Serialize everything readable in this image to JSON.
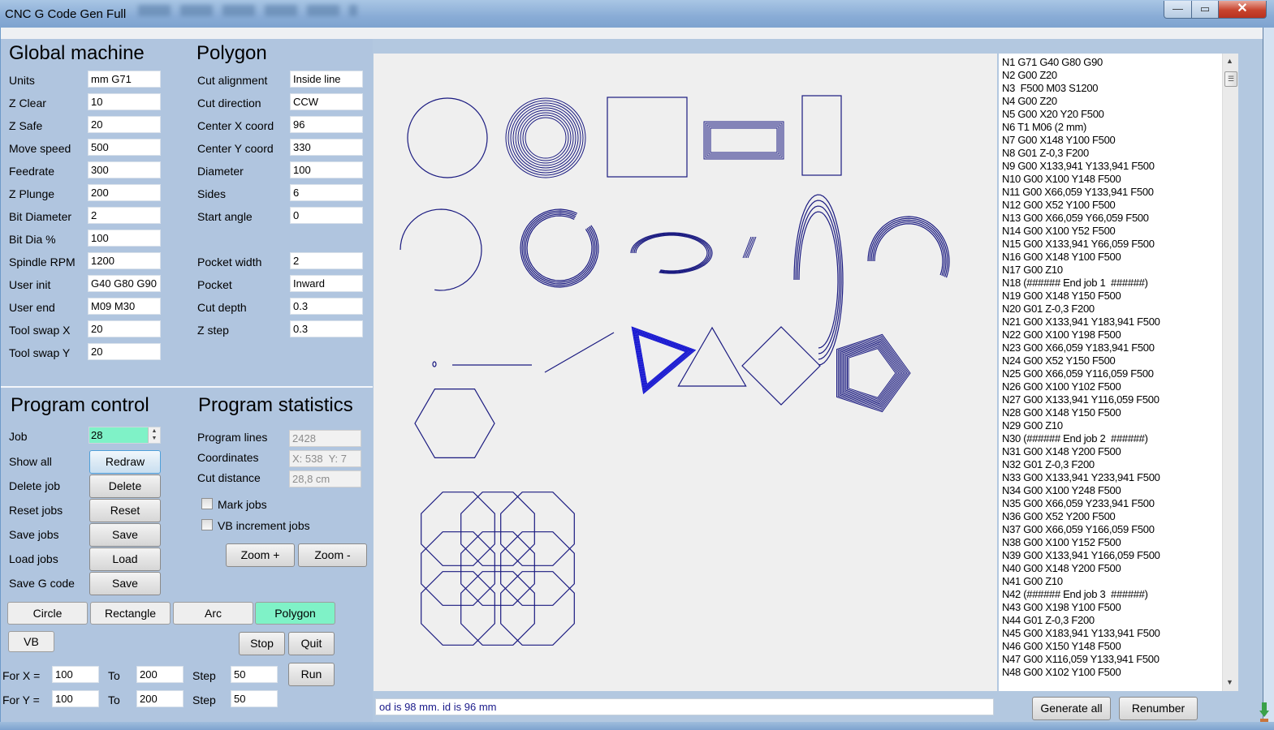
{
  "window": {
    "title": "CNC G Code Gen Full",
    "controls": {
      "minimize": "—",
      "maximize": "▭",
      "close": "✕"
    }
  },
  "global_machine": {
    "heading": "Global machine",
    "fields": [
      {
        "label": "Units",
        "value": "mm G71"
      },
      {
        "label": "Z Clear",
        "value": "10"
      },
      {
        "label": "Z Safe",
        "value": "20"
      },
      {
        "label": "Move speed",
        "value": "500"
      },
      {
        "label": "Feedrate",
        "value": "300"
      },
      {
        "label": "Z Plunge",
        "value": "200"
      },
      {
        "label": "Bit Diameter",
        "value": "2"
      },
      {
        "label": "Bit Dia %",
        "value": "100"
      },
      {
        "label": "Spindle RPM",
        "value": "1200"
      },
      {
        "label": "User init",
        "value": "G40 G80 G90"
      },
      {
        "label": "User end",
        "value": "M09 M30"
      },
      {
        "label": "Tool swap X",
        "value": "20"
      },
      {
        "label": "Tool swap Y",
        "value": "20"
      }
    ]
  },
  "polygon": {
    "heading": "Polygon",
    "fields": [
      {
        "label": "Cut alignment",
        "value": "Inside line"
      },
      {
        "label": "Cut direction",
        "value": "CCW"
      },
      {
        "label": "Center X coord",
        "value": "96"
      },
      {
        "label": "Center Y coord",
        "value": "330"
      },
      {
        "label": "Diameter",
        "value": "100"
      },
      {
        "label": "Sides",
        "value": "6"
      },
      {
        "label": "Start angle",
        "value": "0"
      },
      {
        "label": "Pocket width",
        "value": "2"
      },
      {
        "label": "Pocket",
        "value": "Inward"
      },
      {
        "label": "Cut depth",
        "value": "0.3"
      },
      {
        "label": "Z step",
        "value": "0.3"
      }
    ]
  },
  "program_control": {
    "heading": "Program control",
    "job_label": "Job",
    "job_value": "28",
    "rows": [
      {
        "label": "Show all",
        "button": "Redraw"
      },
      {
        "label": "Delete job",
        "button": "Delete"
      },
      {
        "label": "Reset jobs",
        "button": "Reset"
      },
      {
        "label": "Save jobs",
        "button": "Save"
      },
      {
        "label": "Load jobs",
        "button": "Load"
      },
      {
        "label": "Save G code",
        "button": "Save"
      }
    ]
  },
  "program_statistics": {
    "heading": "Program statistics",
    "program_lines_label": "Program lines",
    "program_lines": "2428",
    "coordinates_label": "Coordinates",
    "coordinates": "X: 538  Y: 7",
    "cut_distance_label": "Cut distance",
    "cut_distance": "28,8 cm",
    "mark_jobs": {
      "label": "Mark jobs",
      "checked": false
    },
    "vb_increment": {
      "label": "VB increment jobs",
      "checked": false
    },
    "zoom_in": "Zoom +",
    "zoom_out": "Zoom -"
  },
  "shape_buttons": {
    "circle": "Circle",
    "rectangle": "Rectangle",
    "arc": "Arc",
    "polygon": "Polygon",
    "active": "Polygon",
    "active_color": "#7ff2c7",
    "vb": "VB",
    "stop": "Stop",
    "quit": "Quit",
    "run": "Run"
  },
  "loop": {
    "for_x_label": "For X =",
    "x_from": "100",
    "x_to_label": "To",
    "x_to": "200",
    "x_step_label": "Step",
    "x_step": "50",
    "for_y_label": "For Y =",
    "y_from": "100",
    "y_to_label": "To",
    "y_to": "200",
    "y_step_label": "Step",
    "y_step": "50"
  },
  "canvas": {
    "stroke_color": "#1a1a80",
    "highlight_color": "#1010d0"
  },
  "gcode_lines": [
    "N1 G71 G40 G80 G90",
    "N2 G00 Z20",
    "N3  F500 M03 S1200",
    "N4 G00 Z20",
    "N5 G00 X20 Y20 F500",
    "N6 T1 M06 (2 mm)",
    "N7 G00 X148 Y100 F500",
    "N8 G01 Z-0,3 F200",
    "N9 G00 X133,941 Y133,941 F500",
    "N10 G00 X100 Y148 F500",
    "N11 G00 X66,059 Y133,941 F500",
    "N12 G00 X52 Y100 F500",
    "N13 G00 X66,059 Y66,059 F500",
    "N14 G00 X100 Y52 F500",
    "N15 G00 X133,941 Y66,059 F500",
    "N16 G00 X148 Y100 F500",
    "N17 G00 Z10",
    "N18 (###### End job 1  ######)",
    "N19 G00 X148 Y150 F500",
    "N20 G01 Z-0,3 F200",
    "N21 G00 X133,941 Y183,941 F500",
    "N22 G00 X100 Y198 F500",
    "N23 G00 X66,059 Y183,941 F500",
    "N24 G00 X52 Y150 F500",
    "N25 G00 X66,059 Y116,059 F500",
    "N26 G00 X100 Y102 F500",
    "N27 G00 X133,941 Y116,059 F500",
    "N28 G00 X148 Y150 F500",
    "N29 G00 Z10",
    "N30 (###### End job 2  ######)",
    "N31 G00 X148 Y200 F500",
    "N32 G01 Z-0,3 F200",
    "N33 G00 X133,941 Y233,941 F500",
    "N34 G00 X100 Y248 F500",
    "N35 G00 X66,059 Y233,941 F500",
    "N36 G00 X52 Y200 F500",
    "N37 G00 X66,059 Y166,059 F500",
    "N38 G00 X100 Y152 F500",
    "N39 G00 X133,941 Y166,059 F500",
    "N40 G00 X148 Y200 F500",
    "N41 G00 Z10",
    "N42 (###### End job 3  ######)",
    "N43 G00 X198 Y100 F500",
    "N44 G01 Z-0,3 F200",
    "N45 G00 X183,941 Y133,941 F500",
    "N46 G00 X150 Y148 F500",
    "N47 G00 X116,059 Y133,941 F500",
    "N48 G00 X102 Y100 F500"
  ],
  "status_text": "od is 98 mm. id is 96 mm",
  "bottom_buttons": {
    "generate_all": "Generate all",
    "renumber": "Renumber"
  }
}
